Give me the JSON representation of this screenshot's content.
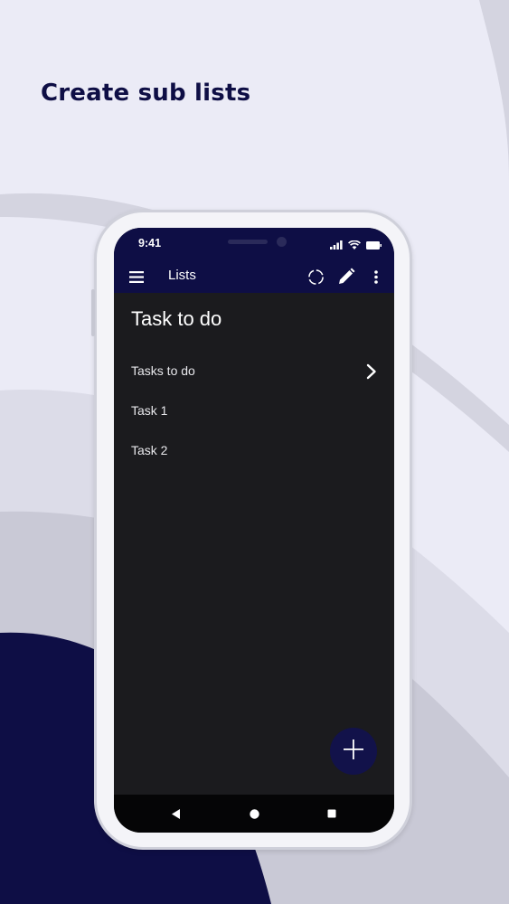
{
  "headline": "Create sub lists",
  "status_bar": {
    "time": "9:41",
    "icons": [
      "signal-icon",
      "wifi-icon",
      "battery-icon"
    ]
  },
  "app_bar": {
    "title": "Lists",
    "icons": [
      "menu-icon",
      "sync-icon",
      "edit-icon",
      "more-vert-icon"
    ]
  },
  "page": {
    "title": "Task to do",
    "items": [
      {
        "label": "Tasks to do",
        "has_children": true
      },
      {
        "label": "Task 1",
        "has_children": false
      },
      {
        "label": "Task 2",
        "has_children": false
      }
    ]
  },
  "fab": {
    "icon": "plus-icon"
  },
  "nav_bar": {
    "icons": [
      "back-icon",
      "home-icon",
      "recents-icon"
    ]
  },
  "colors": {
    "background": "#ebebf6",
    "navy": "#0e0e45",
    "screen": "#1b1b1e",
    "headline": "#0e0e45"
  }
}
